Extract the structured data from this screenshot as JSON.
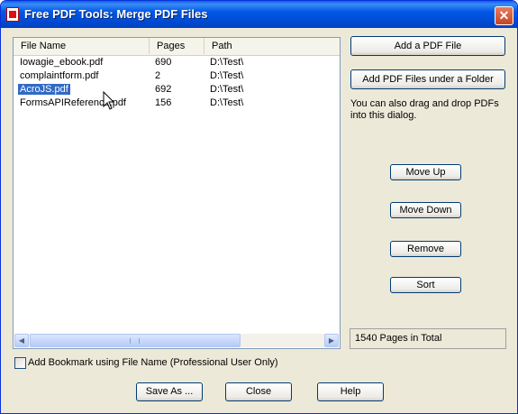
{
  "window": {
    "title": "Free PDF Tools: Merge PDF Files",
    "close_glyph": "✕"
  },
  "list": {
    "columns": {
      "file_name": "File Name",
      "pages": "Pages",
      "path": "Path"
    },
    "rows": [
      {
        "file_name": "Iowagie_ebook.pdf",
        "pages": "690",
        "path": "D:\\Test\\",
        "selected": false
      },
      {
        "file_name": "complaintform.pdf",
        "pages": "2",
        "path": "D:\\Test\\",
        "selected": false
      },
      {
        "file_name": "AcroJS.pdf",
        "pages": "692",
        "path": "D:\\Test\\",
        "selected": true
      },
      {
        "file_name": "FormsAPIReference.pdf",
        "pages": "156",
        "path": "D:\\Test\\",
        "selected": false
      }
    ],
    "scroll_thumb_glyph": "|||"
  },
  "side": {
    "add_file": "Add a PDF File",
    "add_folder": "Add PDF Files under a Folder",
    "hint": "You can also drag and drop PDFs into this dialog.",
    "move_up": "Move Up",
    "move_down": "Move Down",
    "remove": "Remove",
    "sort": "Sort",
    "total": "1540 Pages in Total"
  },
  "options": {
    "bookmark_label": "Add Bookmark using File Name (Professional User Only)",
    "bookmark_checked": false
  },
  "footer": {
    "save_as": "Save As ...",
    "close": "Close",
    "help": "Help"
  },
  "colors": {
    "title_bar": "#0054e3",
    "dialog_bg": "#ece9d8",
    "selection": "#316ac5"
  }
}
